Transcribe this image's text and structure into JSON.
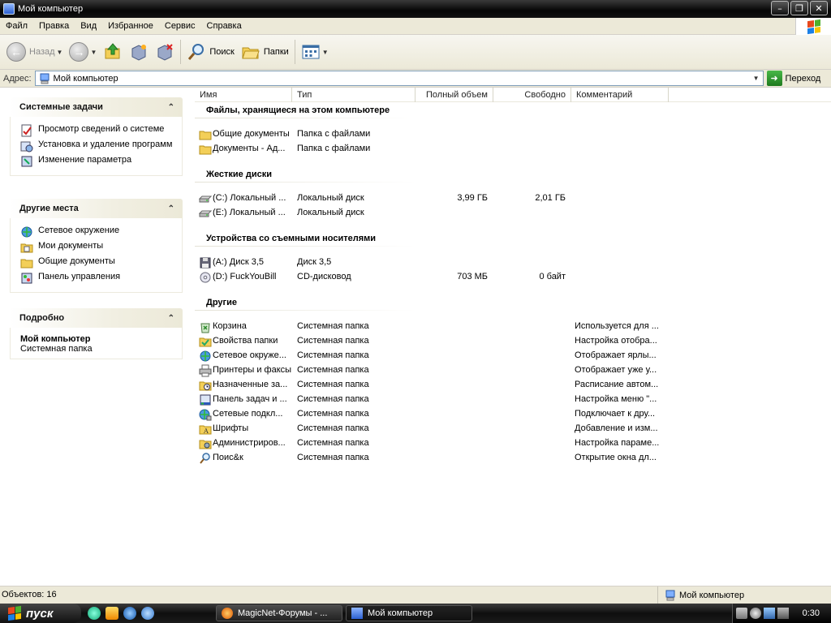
{
  "window": {
    "title": "Мой компьютер"
  },
  "menu": [
    "Файл",
    "Правка",
    "Вид",
    "Избранное",
    "Сервис",
    "Справка"
  ],
  "toolbar": {
    "back": "Назад",
    "search": "Поиск",
    "folders": "Папки"
  },
  "address": {
    "label": "Адрес:",
    "value": "Мой компьютер",
    "go": "Переход"
  },
  "left": {
    "system_tasks": {
      "title": "Системные задачи",
      "items": [
        "Просмотр сведений о системе",
        "Установка и удаление программ",
        "Изменение параметра"
      ]
    },
    "other_places": {
      "title": "Другие места",
      "items": [
        "Сетевое окружение",
        "Мои документы",
        "Общие документы",
        "Панель управления"
      ]
    },
    "details": {
      "title": "Подробно",
      "name": "Мой компьютер",
      "type": "Системная папка"
    }
  },
  "columns": [
    "Имя",
    "Тип",
    "Полный объем",
    "Свободно",
    "Комментарий"
  ],
  "groups": [
    {
      "title": "Файлы, хранящиеся на этом компьютере",
      "rows": [
        {
          "icon": "folder-icon",
          "name": "Общие документы",
          "type": "Папка с файлами",
          "total": "",
          "free": "",
          "comment": ""
        },
        {
          "icon": "folder-icon",
          "name": "Документы - Ад...",
          "type": "Папка с файлами",
          "total": "",
          "free": "",
          "comment": ""
        }
      ]
    },
    {
      "title": "Жесткие диски",
      "rows": [
        {
          "icon": "hard-disk-icon",
          "name": "(C:) Локальный ...",
          "type": "Локальный диск",
          "total": "3,99 ГБ",
          "free": "2,01 ГБ",
          "comment": ""
        },
        {
          "icon": "hard-disk-icon",
          "name": "(E:) Локальный ...",
          "type": "Локальный диск",
          "total": "",
          "free": "",
          "comment": ""
        }
      ]
    },
    {
      "title": "Устройства со съемными носителями",
      "rows": [
        {
          "icon": "floppy-icon",
          "name": "(A:) Диск 3,5",
          "type": "Диск 3,5",
          "total": "",
          "free": "",
          "comment": ""
        },
        {
          "icon": "cd-drive-icon",
          "name": "(D:) FuckYouBill",
          "type": "CD-дисковод",
          "total": "703 МБ",
          "free": "0 байт",
          "comment": ""
        }
      ]
    },
    {
      "title": "Другие",
      "rows": [
        {
          "icon": "recycle-bin-icon",
          "name": "Корзина",
          "type": "Системная папка",
          "total": "",
          "free": "",
          "comment": "Используется для ..."
        },
        {
          "icon": "folder-options-icon",
          "name": "Свойства папки",
          "type": "Системная папка",
          "total": "",
          "free": "",
          "comment": "Настройка отобра..."
        },
        {
          "icon": "network-icon",
          "name": "Сетевое окруже...",
          "type": "Системная папка",
          "total": "",
          "free": "",
          "comment": "Отображает ярлы..."
        },
        {
          "icon": "printer-icon",
          "name": "Принтеры и факсы",
          "type": "Системная папка",
          "total": "",
          "free": "",
          "comment": "Отображает уже у..."
        },
        {
          "icon": "scheduled-tasks-icon",
          "name": "Назначенные за...",
          "type": "Системная папка",
          "total": "",
          "free": "",
          "comment": "Расписание автом..."
        },
        {
          "icon": "taskbar-settings-icon",
          "name": "Панель задач и ...",
          "type": "Системная папка",
          "total": "",
          "free": "",
          "comment": "Настройка меню \"..."
        },
        {
          "icon": "network-connections-icon",
          "name": "Сетевые подкл...",
          "type": "Системная папка",
          "total": "",
          "free": "",
          "comment": "Подключает к дру..."
        },
        {
          "icon": "fonts-icon",
          "name": "Шрифты",
          "type": "Системная папка",
          "total": "",
          "free": "",
          "comment": "Добавление и изм..."
        },
        {
          "icon": "admin-tools-icon",
          "name": "Администриров...",
          "type": "Системная папка",
          "total": "",
          "free": "",
          "comment": "Настройка параме..."
        },
        {
          "icon": "search-icon",
          "name": "Поис&к",
          "type": "Системная папка",
          "total": "",
          "free": "",
          "comment": "Открытие окна дл..."
        }
      ]
    }
  ],
  "status": {
    "left": "Объектов: 16",
    "right": "Мой компьютер"
  },
  "taskbar": {
    "start": "пуск",
    "tasks": [
      "MagicNet-Форумы - ...",
      "Мой компьютер"
    ],
    "clock": "0:30"
  }
}
